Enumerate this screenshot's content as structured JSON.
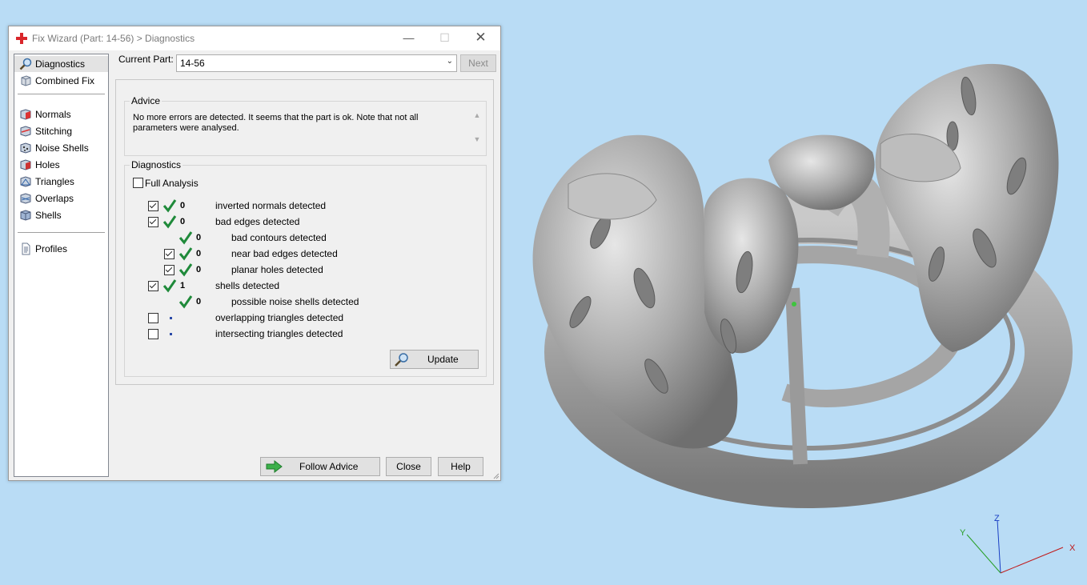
{
  "window": {
    "title": "Fix Wizard (Part: 14-56) > Diagnostics"
  },
  "nav": {
    "items": [
      {
        "label": "Diagnostics",
        "icon": "magnifier-icon",
        "selected": true
      },
      {
        "label": "Combined Fix",
        "icon": "cube-icon"
      },
      {
        "label": "Normals",
        "icon": "normals-cube-icon"
      },
      {
        "label": "Stitching",
        "icon": "stitching-icon"
      },
      {
        "label": "Noise Shells",
        "icon": "noise-shells-icon"
      },
      {
        "label": "Holes",
        "icon": "holes-cube-icon"
      },
      {
        "label": "Triangles",
        "icon": "triangles-icon"
      },
      {
        "label": "Overlaps",
        "icon": "overlaps-icon"
      },
      {
        "label": "Shells",
        "icon": "shells-icon"
      },
      {
        "label": "Profiles",
        "icon": "profiles-document-icon"
      }
    ]
  },
  "current_part": {
    "label": "Current Part:",
    "value": "14-56",
    "next_label": "Next"
  },
  "advice": {
    "title": "Advice",
    "text": "No more errors are detected. It seems that the part is ok. Note that not all parameters were analysed."
  },
  "diagnostics": {
    "title": "Diagnostics",
    "full_analysis_label": "Full Analysis",
    "full_analysis_checked": false,
    "rows": [
      {
        "count": "0",
        "label": "inverted normals detected",
        "checked": true,
        "status": "ok"
      },
      {
        "count": "0",
        "label": "bad edges detected",
        "checked": true,
        "status": "ok"
      },
      {
        "count": "0",
        "label": "bad contours detected",
        "checked": null,
        "status": "ok"
      },
      {
        "count": "0",
        "label": "near bad edges detected",
        "checked": true,
        "status": "ok"
      },
      {
        "count": "0",
        "label": "planar holes detected",
        "checked": true,
        "status": "ok"
      },
      {
        "count": "1",
        "label": "shells detected",
        "checked": true,
        "status": "ok"
      },
      {
        "count": "0",
        "label": "possible noise shells detected",
        "checked": null,
        "status": "ok"
      },
      {
        "count": "",
        "label": "overlapping triangles detected",
        "checked": false,
        "status": "not-analysed"
      },
      {
        "count": "",
        "label": "intersecting triangles detected",
        "checked": false,
        "status": "not-analysed"
      }
    ],
    "update_label": "Update"
  },
  "buttons": {
    "follow_advice": "Follow Advice",
    "close": "Close",
    "help": "Help"
  },
  "viewport": {
    "axes": {
      "x": "X",
      "y": "Y",
      "z": "Z"
    },
    "background": "#b9dcf5"
  },
  "colors": {
    "ok_check": "#1f8a3a",
    "not_analysed_dot": "#2a4aa8",
    "title_icon": "#d9262b"
  }
}
